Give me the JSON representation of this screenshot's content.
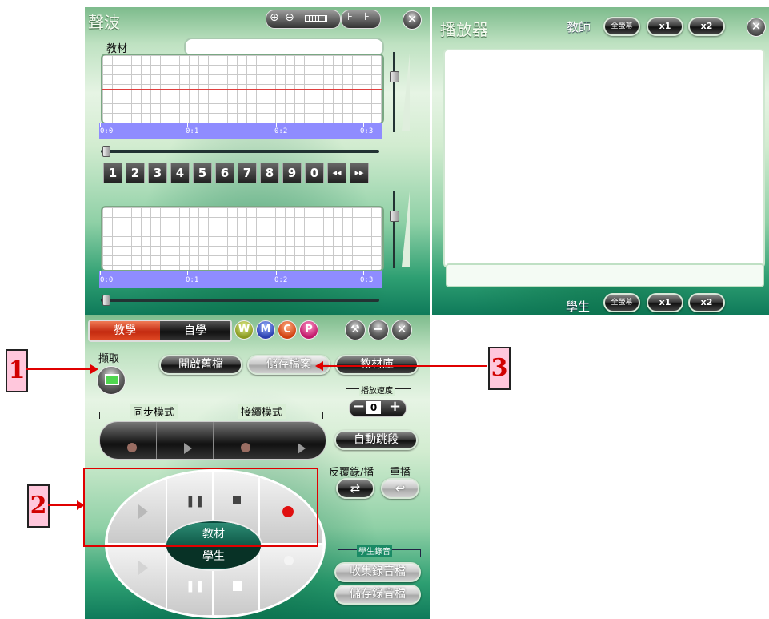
{
  "waveform_panel": {
    "title": "聲波",
    "material_label": "教材",
    "time_ticks": [
      "0:0",
      "0:1",
      "0:2",
      "0:3"
    ],
    "number_keys": [
      "1",
      "2",
      "3",
      "4",
      "5",
      "6",
      "7",
      "8",
      "9",
      "0",
      "◂◂",
      "▸▸"
    ]
  },
  "player_panel": {
    "title": "播放器",
    "teacher_label": "教師",
    "student_label": "學生",
    "fullscreen": "全螢幕",
    "x1": "x1",
    "x2": "x2"
  },
  "control_panel": {
    "mode_teach": "教學",
    "mode_self": "自學",
    "badges": [
      "W",
      "M",
      "C",
      "P"
    ],
    "capture_label": "擷取",
    "open_file": "開啟舊檔",
    "save_file": "儲存檔案",
    "library": "教材庫",
    "playback_speed_label": "播放速度",
    "speed_value": "0",
    "sync_mode": "同步模式",
    "continuous_mode": "接續模式",
    "auto_skip": "自動跳段",
    "repeat_record_play": "反覆錄/播",
    "replay": "重播",
    "material_center": "教材",
    "student_center": "學生",
    "student_recording": "學生錄音",
    "collect_recordings": "收集錄音檔",
    "save_recordings": "儲存錄音檔"
  },
  "callouts": [
    "1",
    "2",
    "3"
  ],
  "colors": {
    "accent_red": "#e00000",
    "timeline_blue": "#8f8cff",
    "mode_active": "#d83a1a",
    "record_dot": "#e01010"
  }
}
